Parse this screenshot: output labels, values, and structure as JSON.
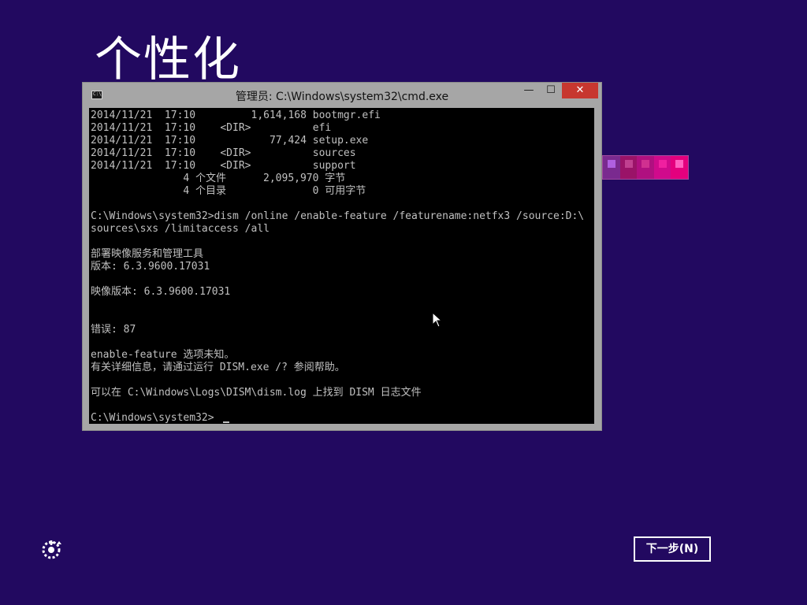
{
  "page_title": "个性化",
  "swatch_colors": [
    "#7a2a8f",
    "#9a1368",
    "#b01080",
    "#d00a8c",
    "#e4007e"
  ],
  "swatch_dot_colors": [
    "#b060e0",
    "#c04090",
    "#d03090",
    "#f020a0",
    "#ff60c0"
  ],
  "cmd_window": {
    "title": "管理员: C:\\Windows\\system32\\cmd.exe",
    "minimize_label": "—",
    "maximize_label": "☐",
    "close_label": "✕",
    "console_lines": [
      "2014/11/21  17:10         1,614,168 bootmgr.efi",
      "2014/11/21  17:10    <DIR>          efi",
      "2014/11/21  17:10            77,424 setup.exe",
      "2014/11/21  17:10    <DIR>          sources",
      "2014/11/21  17:10    <DIR>          support",
      "               4 个文件      2,095,970 字节",
      "               4 个目录              0 可用字节",
      "",
      "C:\\Windows\\system32>dism /online /enable-feature /featurename:netfx3 /source:D:\\",
      "sources\\sxs /limitaccess /all",
      "",
      "部署映像服务和管理工具",
      "版本: 6.3.9600.17031",
      "",
      "映像版本: 6.3.9600.17031",
      "",
      "",
      "错误: 87",
      "",
      "enable-feature 选项未知。",
      "有关详细信息，请通过运行 DISM.exe /? 参阅帮助。",
      "",
      "可以在 C:\\Windows\\Logs\\DISM\\dism.log 上找到 DISM 日志文件",
      "",
      "C:\\Windows\\system32>"
    ]
  },
  "next_button_label": "下一步(N)"
}
